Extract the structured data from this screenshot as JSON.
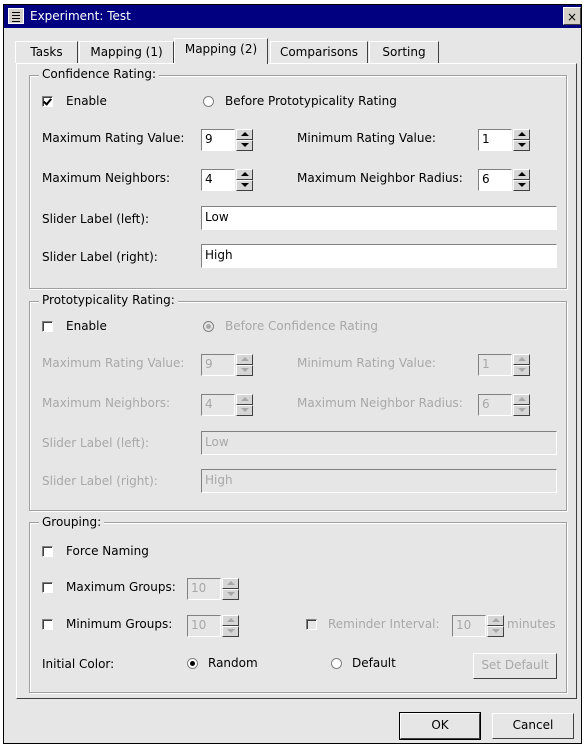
{
  "window": {
    "title": "Experiment: Test",
    "close_glyph": "×"
  },
  "tabs": [
    {
      "label": "Tasks"
    },
    {
      "label": "Mapping (1)"
    },
    {
      "label": "Mapping (2)"
    },
    {
      "label": "Comparisons"
    },
    {
      "label": "Sorting"
    }
  ],
  "active_tab": "Mapping (2)",
  "confidence": {
    "title": "Confidence Rating:",
    "enable_label": "Enable",
    "enable_checked": true,
    "before_label": "Before Prototypicality Rating",
    "before_selected": false,
    "max_rating_label": "Maximum Rating Value:",
    "max_rating_value": "9",
    "min_rating_label": "Minimum Rating Value:",
    "min_rating_value": "1",
    "max_neighbors_label": "Maximum Neighbors:",
    "max_neighbors_value": "4",
    "max_radius_label": "Maximum Neighbor Radius:",
    "max_radius_value": "6",
    "slider_left_label": "Slider Label (left):",
    "slider_left_value": "Low",
    "slider_right_label": "Slider Label (right):",
    "slider_right_value": "High"
  },
  "prototypicality": {
    "title": "Prototypicality Rating:",
    "enable_label": "Enable",
    "enable_checked": false,
    "before_label": "Before Confidence Rating",
    "before_selected": true,
    "max_rating_label": "Maximum Rating Value:",
    "max_rating_value": "9",
    "min_rating_label": "Minimum Rating Value:",
    "min_rating_value": "1",
    "max_neighbors_label": "Maximum Neighbors:",
    "max_neighbors_value": "4",
    "max_radius_label": "Maximum Neighbor Radius:",
    "max_radius_value": "6",
    "slider_left_label": "Slider Label (left):",
    "slider_left_value": "Low",
    "slider_right_label": "Slider Label (right):",
    "slider_right_value": "High"
  },
  "grouping": {
    "title": "Grouping:",
    "force_naming_label": "Force Naming",
    "max_groups_label": "Maximum Groups:",
    "max_groups_value": "10",
    "min_groups_label": "Minimum Groups:",
    "min_groups_value": "10",
    "reminder_label": "Reminder Interval:",
    "reminder_value": "10",
    "minutes_label": "minutes",
    "initial_color_label": "Initial Color:",
    "random_label": "Random",
    "random_selected": true,
    "default_label": "Default",
    "set_default_label": "Set Default"
  },
  "footer": {
    "ok_label": "OK",
    "cancel_label": "Cancel"
  }
}
